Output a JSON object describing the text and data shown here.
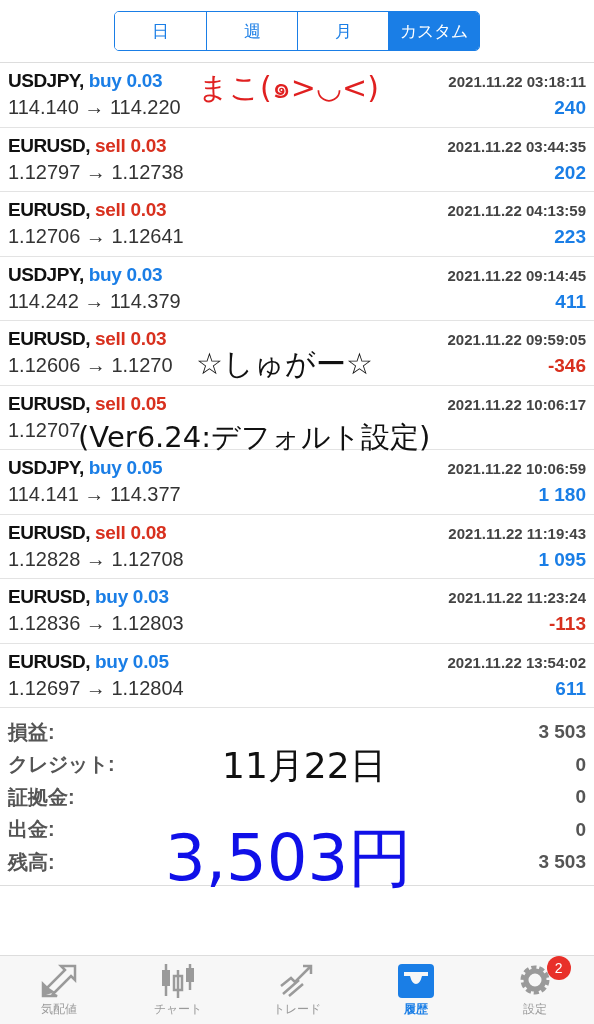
{
  "tabs": [
    {
      "label": "日",
      "selected": false
    },
    {
      "label": "週",
      "selected": false
    },
    {
      "label": "月",
      "selected": false
    },
    {
      "label": "カスタム",
      "selected": true
    }
  ],
  "trades": [
    {
      "symbol": "USDJPY,",
      "kind": "buy",
      "order": "buy 0.03",
      "time": "2021.11.22 03:18:11",
      "prices": "114.140 → 114.220",
      "profit": "240",
      "loss": false
    },
    {
      "symbol": "EURUSD,",
      "kind": "sell",
      "order": "sell 0.03",
      "time": "2021.11.22 03:44:35",
      "prices": "1.12797 → 1.12738",
      "profit": "202",
      "loss": false
    },
    {
      "symbol": "EURUSD,",
      "kind": "sell",
      "order": "sell 0.03",
      "time": "2021.11.22 04:13:59",
      "prices": "1.12706 → 1.12641",
      "profit": "223",
      "loss": false
    },
    {
      "symbol": "USDJPY,",
      "kind": "buy",
      "order": "buy 0.03",
      "time": "2021.11.22 09:14:45",
      "prices": "114.242 → 114.379",
      "profit": "411",
      "loss": false
    },
    {
      "symbol": "EURUSD,",
      "kind": "sell",
      "order": "sell 0.03",
      "time": "2021.11.22 09:59:05",
      "prices": "1.12606 → 1.1270",
      "profit": "-346",
      "loss": true
    },
    {
      "symbol": "EURUSD,",
      "kind": "sell",
      "order": "sell 0.05",
      "time": "2021.11.22 10:06:17",
      "prices": "1.12707"
    },
    {
      "symbol": "USDJPY,",
      "kind": "buy",
      "order": "buy 0.05",
      "time": "2021.11.22 10:06:59",
      "prices": "114.141 → 114.377",
      "profit": "1 180",
      "loss": false
    },
    {
      "symbol": "EURUSD,",
      "kind": "sell",
      "order": "sell 0.08",
      "time": "2021.11.22 11:19:43",
      "prices": "1.12828 → 1.12708",
      "profit": "1 095",
      "loss": false
    },
    {
      "symbol": "EURUSD,",
      "kind": "buy",
      "order": "buy 0.03",
      "time": "2021.11.22 11:23:24",
      "prices": "1.12836 → 1.12803",
      "profit": "-113",
      "loss": true
    },
    {
      "symbol": "EURUSD,",
      "kind": "buy",
      "order": "buy 0.05",
      "time": "2021.11.22 13:54:02",
      "prices": "1.12697 → 1.12804",
      "profit": "611",
      "loss": false
    }
  ],
  "summary": [
    {
      "label": "損益:",
      "value": "3 503"
    },
    {
      "label": "クレジット:",
      "value": "0"
    },
    {
      "label": "証拠金:",
      "value": "0"
    },
    {
      "label": "出金:",
      "value": "0"
    },
    {
      "label": "残高:",
      "value": "3 503"
    }
  ],
  "annotations": [
    {
      "kind": "name",
      "text": "まこ(๑>◡<)",
      "color": "#e02020"
    },
    {
      "kind": "star",
      "text": "☆しゅがー☆",
      "color": "#111111"
    },
    {
      "kind": "version",
      "text": "(Ver6.24:デフォルト設定)",
      "color": "#111111"
    },
    {
      "kind": "date",
      "text": "11月22日",
      "color": "#111111"
    },
    {
      "kind": "amount",
      "text": "3,503円",
      "color": "#1010e8"
    }
  ],
  "nav": [
    {
      "kind": "quotes",
      "label": "気配値",
      "selected": false
    },
    {
      "kind": "chart",
      "label": "チャート",
      "selected": false
    },
    {
      "kind": "trade",
      "label": "トレード",
      "selected": false
    },
    {
      "kind": "history",
      "label": "履歴",
      "selected": true
    },
    {
      "kind": "settings",
      "label": "設定",
      "selected": false,
      "badge": "2"
    }
  ]
}
